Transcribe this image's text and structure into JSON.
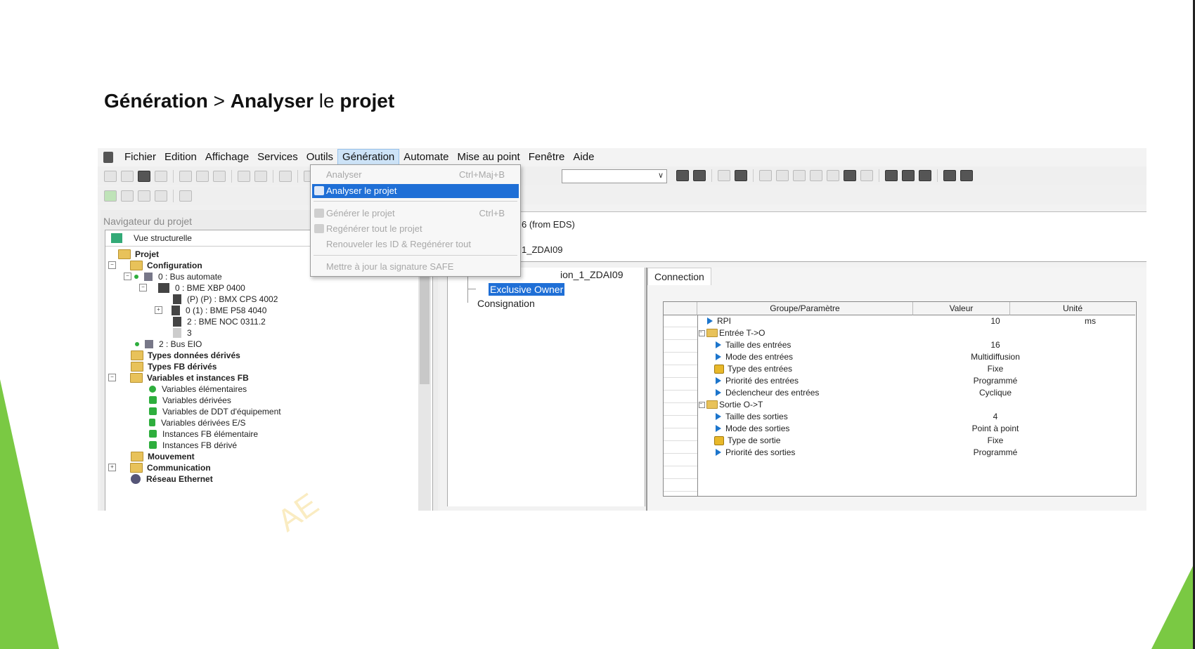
{
  "slide": {
    "title_part1": "Génération",
    "title_sep": " > ",
    "title_part2": "Analyser",
    "title_part3": " le ",
    "title_part4": "projet",
    "watermark": "AE"
  },
  "menubar": {
    "items": [
      "Fichier",
      "Edition",
      "Affichage",
      "Services",
      "Outils",
      "Génération",
      "Automate",
      "Mise au point",
      "Fenêtre",
      "Aide"
    ],
    "open_index": 5
  },
  "generation_menu": {
    "analyser": {
      "label": "Analyser",
      "shortcut": "Ctrl+Maj+B"
    },
    "analyser_projet": {
      "label": "Analyser le projet"
    },
    "generer_projet": {
      "label": "Générer le projet",
      "shortcut": "Ctrl+B"
    },
    "regenerer_tout": {
      "label": "Regénérer tout le projet"
    },
    "renouveler": {
      "label": "Renouveler les ID & Regénérer tout"
    },
    "mettre_a_jour": {
      "label": "Mettre à jour la signature SAFE"
    }
  },
  "navigator": {
    "title": "Navigateur du projet",
    "view": "Vue structurelle",
    "tree": {
      "projet": "Projet",
      "configuration": "Configuration",
      "bus_automate": "0 : Bus automate",
      "xbp": "0 : BME XBP 0400",
      "cps": "(P) (P) : BMX CPS 4002",
      "p58": "0 (1) : BME P58 4040",
      "noc": "2 : BME NOC 0311.2",
      "slot3": "3",
      "bus_eio": "2 : Bus EIO",
      "types_donnees": "Types données dérivés",
      "types_fb": "Types FB dérivés",
      "variables": "Variables et instances FB",
      "var_elem": "Variables élémentaires",
      "var_der": "Variables dérivées",
      "var_ddt": "Variables de DDT d'équipement",
      "var_es": "Variables dérivées E/S",
      "fb_elem": "Instances FB élémentaire",
      "fb_der": "Instances FB dérivé",
      "mouvement": "Mouvement",
      "communication": "Communication",
      "reseau": "Réseau Ethernet"
    }
  },
  "main": {
    "header_line1": "6 (from EDS)",
    "header_line2": "1_ZDAI09",
    "tree_item": "ion_1_ZDAI09",
    "exclusive_owner": "Exclusive Owner",
    "consignation": "Consignation",
    "connection_tab": "Connection"
  },
  "param_table": {
    "headers": {
      "groupe": "Groupe/Paramètre",
      "valeur": "Valeur",
      "unite": "Unité"
    },
    "rows": [
      {
        "name": "RPI",
        "value": "10",
        "unit": "ms"
      },
      {
        "name": "Entrée T->O",
        "value": "",
        "unit": ""
      },
      {
        "name": "Taille des entrées",
        "value": "16",
        "unit": ""
      },
      {
        "name": "Mode des entrées",
        "value": "Multidiffusion",
        "unit": ""
      },
      {
        "name": "Type des entrées",
        "value": "Fixe",
        "unit": ""
      },
      {
        "name": "Priorité des entrées",
        "value": "Programmé",
        "unit": ""
      },
      {
        "name": "Déclencheur des entrées",
        "value": "Cyclique",
        "unit": ""
      },
      {
        "name": "Sortie O->T",
        "value": "",
        "unit": ""
      },
      {
        "name": "Taille des sorties",
        "value": "4",
        "unit": ""
      },
      {
        "name": "Mode des sorties",
        "value": "Point à point",
        "unit": ""
      },
      {
        "name": "Type de sortie",
        "value": "Fixe",
        "unit": ""
      },
      {
        "name": "Priorité des sorties",
        "value": "Programmé",
        "unit": ""
      }
    ]
  },
  "colors": {
    "green": "#7ac943",
    "selection": "#1f6fd6"
  }
}
